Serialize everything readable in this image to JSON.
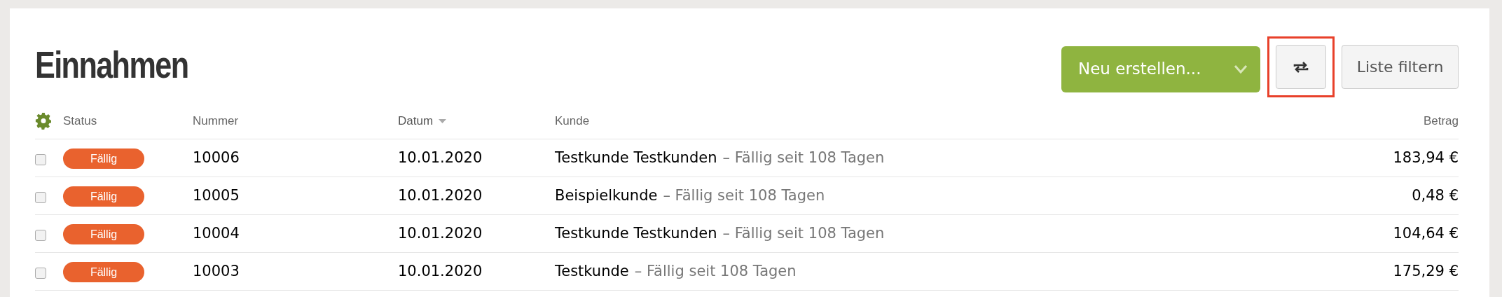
{
  "title": "Einnahmen",
  "actions": {
    "create": "Neu erstellen...",
    "swap_highlighted": true,
    "filter": "Liste filtern"
  },
  "columns": [
    {
      "label": "Status",
      "sorted": false
    },
    {
      "label": "Nummer",
      "sorted": false
    },
    {
      "label": "Datum",
      "sorted": true
    },
    {
      "label": "Kunde",
      "sorted": false
    },
    {
      "label": "Betrag",
      "sorted": false
    }
  ],
  "rows": [
    {
      "checked": false,
      "status": "Fällig",
      "number": "10006",
      "date": "10.01.2020",
      "customer": "Testkunde Testkunden",
      "note": "– Fällig seit 108 Tagen",
      "amount": "183,94 €"
    },
    {
      "checked": false,
      "status": "Fällig",
      "number": "10005",
      "date": "10.01.2020",
      "customer": "Beispielkunde",
      "note": "– Fällig seit 108 Tagen",
      "amount": "0,48 €"
    },
    {
      "checked": false,
      "status": "Fällig",
      "number": "10004",
      "date": "10.01.2020",
      "customer": "Testkunde Testkunden",
      "note": "– Fällig seit 108 Tagen",
      "amount": "104,64 €"
    },
    {
      "checked": false,
      "status": "Fällig",
      "number": "10003",
      "date": "10.01.2020",
      "customer": "Testkunde",
      "note": "– Fällig seit 108 Tagen",
      "amount": "175,29 €"
    }
  ]
}
